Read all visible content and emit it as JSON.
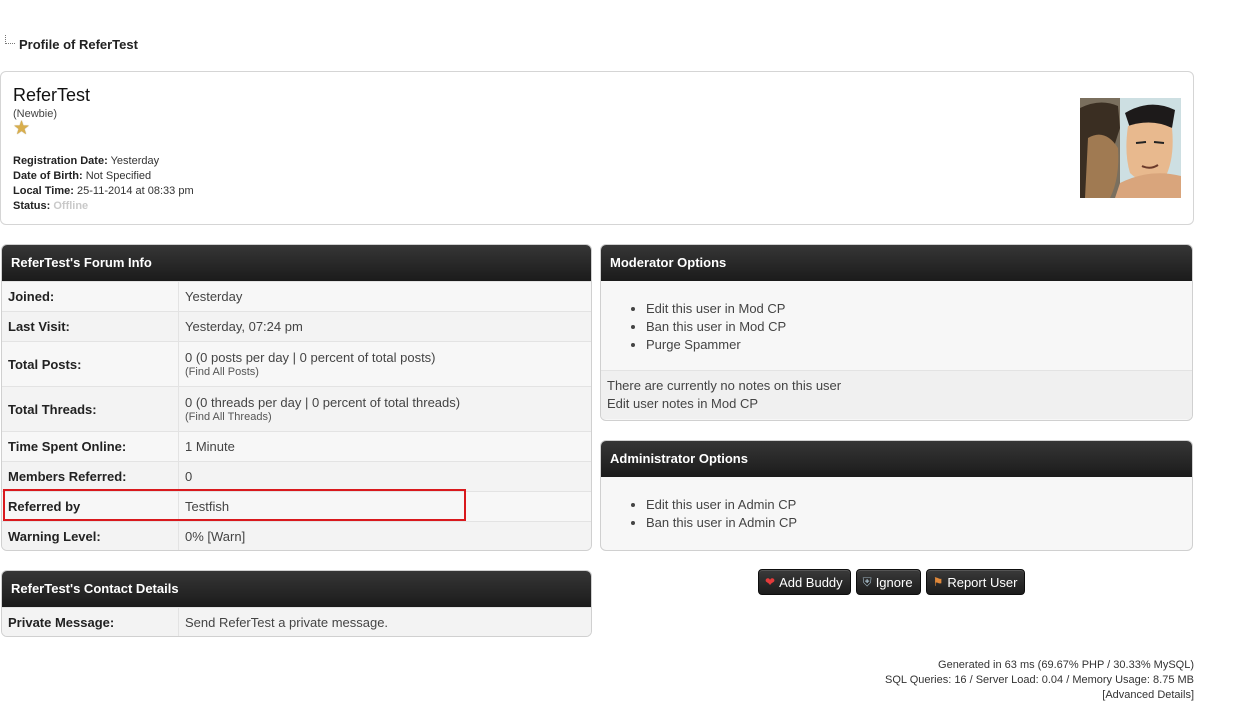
{
  "breadcrumb": {
    "title": "Profile of ReferTest"
  },
  "profile": {
    "name": "ReferTest",
    "rank": "(Newbie)",
    "star_icon": "star-icon",
    "registration_label": "Registration Date:",
    "registration_value": "Yesterday",
    "dob_label": "Date of Birth:",
    "dob_value": "Not Specified",
    "localtime_label": "Local Time:",
    "localtime_value": "25-11-2014 at 08:33 pm",
    "status_label": "Status:",
    "status_value": "Offline"
  },
  "forum_info": {
    "title": "ReferTest's Forum Info",
    "rows": [
      {
        "label": "Joined:",
        "value": "Yesterday"
      },
      {
        "label": "Last Visit:",
        "value": "Yesterday, 07:24 pm"
      },
      {
        "label": "Total Posts:",
        "value": "0 (0 posts per day | 0 percent of total posts)",
        "sub": "(Find All Posts)"
      },
      {
        "label": "Total Threads:",
        "value": "0 (0 threads per day | 0 percent of total threads)",
        "sub": "(Find All Threads)"
      },
      {
        "label": "Time Spent Online:",
        "value": "1 Minute"
      },
      {
        "label": "Members Referred:",
        "value": "0"
      },
      {
        "label": "Referred by",
        "value": "Testfish"
      },
      {
        "label": "Warning Level:",
        "value": "0% [Warn]"
      }
    ]
  },
  "contact": {
    "title": "ReferTest's Contact Details",
    "label": "Private Message:",
    "value": "Send ReferTest a private message."
  },
  "moderator": {
    "title": "Moderator Options",
    "items": [
      "Edit this user in Mod CP",
      "Ban this user in Mod CP",
      "Purge Spammer"
    ],
    "notes_text": "There are currently no notes on this user",
    "notes_link": "Edit user notes in Mod CP"
  },
  "admin": {
    "title": "Administrator Options",
    "items": [
      "Edit this user in Admin CP",
      "Ban this user in Admin CP"
    ]
  },
  "buttons": {
    "add_buddy": "Add Buddy",
    "ignore": "Ignore",
    "report": "Report User"
  },
  "footer": {
    "line1": "Generated in 63 ms (69.67% PHP / 30.33% MySQL)",
    "line2": "SQL Queries: 16 / Server Load: 0.04 / Memory Usage: 8.75 MB",
    "line3": "[Advanced Details]"
  },
  "colors": {
    "header_bg": "#1f1f1f",
    "highlight": "#d9191d",
    "offline": "#c9c9c9"
  }
}
